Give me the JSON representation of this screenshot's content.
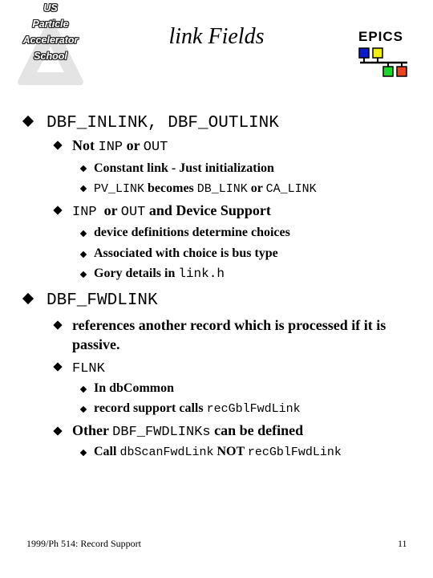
{
  "header": {
    "logo_lines": [
      "US",
      "Particle",
      "Accelerator",
      "School"
    ],
    "title": "link Fields",
    "brand": "EPICS",
    "brand_colors": {
      "blue": "#0a1acc",
      "yellow": "#f2ee10",
      "green": "#18d82a",
      "red": "#e84420"
    }
  },
  "content": {
    "item1": {
      "label": "DBF_INLINK, DBF_OUTLINK",
      "sub1": {
        "prefix": "Not ",
        "code1": "INP",
        "mid": " or ",
        "code2": "OUT",
        "children": [
          {
            "text": "Constant link - Just initialization"
          },
          {
            "code1": "PV_LINK",
            "mid1": " becomes ",
            "code2": "DB_LINK",
            "mid2": " or ",
            "code3": "CA_LINK"
          }
        ]
      },
      "sub2": {
        "code1": "INP",
        "mid": " or ",
        "code2": "OUT",
        "suffix": " and Device Support",
        "children": [
          {
            "text": "device definitions determine choices"
          },
          {
            "text": "Associated with choice is bus type"
          },
          {
            "prefix": "Gory details in ",
            "code": "link.h"
          }
        ]
      }
    },
    "item2": {
      "label": "DBF_FWDLINK",
      "sub1": {
        "line1": "references another record which is processed if it is",
        "line2": "passive."
      },
      "sub2": {
        "code": "FLNK",
        "children": [
          {
            "text": "In dbCommon"
          },
          {
            "prefix": "record support calls ",
            "code": "recGblFwdLink"
          }
        ]
      },
      "sub3": {
        "prefix": "Other ",
        "code": "DBF_FWDLINKs",
        "suffix": " can be defined",
        "children": [
          {
            "prefix": "Call ",
            "code1": "dbScanFwdLink",
            "mid": " NOT ",
            "code2": "recGblFwdLink"
          }
        ]
      }
    }
  },
  "footer": {
    "left": "1999/Ph 514: Record Support",
    "page": "11"
  }
}
